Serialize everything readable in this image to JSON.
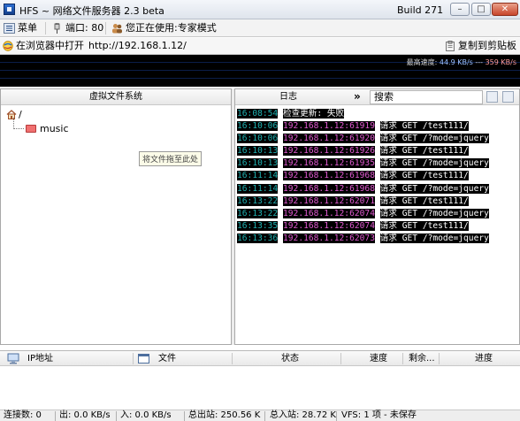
{
  "window": {
    "title": "HFS ~ 网络文件服务器 2.3 beta",
    "build": "Build 271"
  },
  "menubar": {
    "menu": "菜单",
    "port": "端口: 80",
    "mode": "您正在使用:专家模式"
  },
  "urlbar": {
    "open_in_browser": "在浏览器中打开",
    "url": "http://192.168.1.12/",
    "copy_to_clipboard": "复制到剪贴板"
  },
  "graph": {
    "label": "最高速度:",
    "in_speed": "44.9 KB/s",
    "separator": " --- ",
    "out_speed": "359 KB/s"
  },
  "vfs": {
    "header": "虚拟文件系统",
    "root": "/",
    "items": [
      {
        "name": "music"
      }
    ],
    "drop_hint": "将文件拖至此处"
  },
  "log": {
    "header": "日志",
    "search_placeholder": "搜索",
    "entries": [
      {
        "time": "16:08:54",
        "ip": "",
        "message": "检查更新: 失败"
      },
      {
        "time": "16:10:06",
        "ip": "192.168.1.12:61919",
        "message": "请求 GET /test111/"
      },
      {
        "time": "16:10:06",
        "ip": "192.168.1.12:61920",
        "message": "请求 GET /?mode=jquery"
      },
      {
        "time": "16:10:13",
        "ip": "192.168.1.12:61926",
        "message": "请求 GET /test111/"
      },
      {
        "time": "16:10:13",
        "ip": "192.168.1.12:61935",
        "message": "请求 GET /?mode=jquery"
      },
      {
        "time": "16:11:14",
        "ip": "192.168.1.12:61968",
        "message": "请求 GET /test111/"
      },
      {
        "time": "16:11:14",
        "ip": "192.168.1.12:61968",
        "message": "请求 GET /?mode=jquery"
      },
      {
        "time": "16:13:22",
        "ip": "192.168.1.12:62071",
        "message": "请求 GET /test111/"
      },
      {
        "time": "16:13:22",
        "ip": "192.168.1.12:62074",
        "message": "请求 GET /?mode=jquery"
      },
      {
        "time": "16:13:35",
        "ip": "192.168.1.12:62074",
        "message": "请求 GET /test111/"
      },
      {
        "time": "16:13:36",
        "ip": "192.168.1.12:62073",
        "message": "请求 GET /?mode=jquery"
      }
    ]
  },
  "connections": {
    "columns": {
      "ip": "IP地址",
      "file": "文件",
      "status": "状态",
      "speed": "速度",
      "remaining": "剩余...",
      "progress": "进度"
    }
  },
  "status": {
    "connections": "连接数: 0",
    "out_speed": "出: 0.0 KB/s",
    "in_speed": "入: 0.0 KB/s",
    "total_out": "总出站: 250.56 K",
    "total_in": "总入站: 28.72 K",
    "vfs": "VFS: 1 项 - 未保存"
  },
  "colors": {
    "graph_bg": "#000000",
    "log_time": "#1fb0b0",
    "log_ip": "#e05ad0",
    "log_text": "#ffffff",
    "log_bg": "#000000",
    "folder": "#f07070"
  }
}
